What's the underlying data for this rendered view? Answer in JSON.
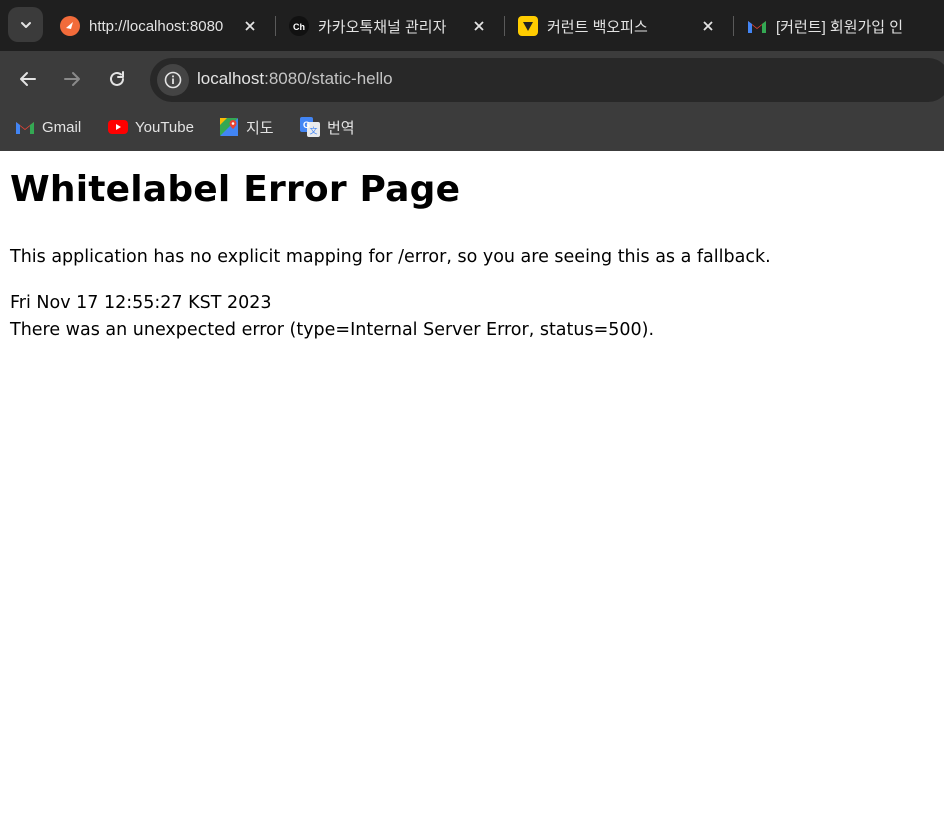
{
  "browser": {
    "tabs": [
      {
        "title": "http://localhost:8080",
        "favicon": "orange-leaf-icon"
      },
      {
        "title": "카카오톡채널 관리자",
        "favicon": "kakao-channel-icon"
      },
      {
        "title": "커런트 백오피스",
        "favicon": "yellow-shield-icon"
      },
      {
        "title": "[커런트] 회원가입 인",
        "favicon": "gmail-icon"
      }
    ],
    "address": {
      "host": "localhost",
      "rest": ":8080/static-hello"
    },
    "bookmarks": [
      {
        "label": "Gmail",
        "icon": "gmail-icon"
      },
      {
        "label": "YouTube",
        "icon": "youtube-icon"
      },
      {
        "label": "지도",
        "icon": "maps-icon"
      },
      {
        "label": "번역",
        "icon": "translate-icon"
      }
    ],
    "colors": {
      "tabstrip": "#1f1f1f",
      "toolbar": "#3c3c3c",
      "omnibox": "#282828"
    }
  },
  "page": {
    "heading": "Whitelabel Error Page",
    "message": "This application has no explicit mapping for /error, so you are seeing this as a fallback.",
    "timestamp": "Fri Nov 17 12:55:27 KST 2023",
    "error": "There was an unexpected error (type=Internal Server Error, status=500)."
  }
}
